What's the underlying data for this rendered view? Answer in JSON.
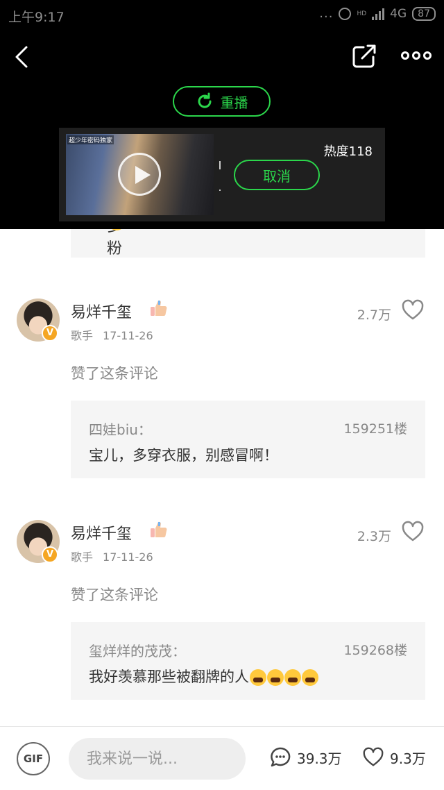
{
  "status_bar": {
    "time": "上午9:17",
    "dots": "...",
    "network": "4G",
    "network_small": "HD",
    "battery": "87"
  },
  "toolbar": {
    "back_icon": "chevron-left-icon",
    "share_icon": "share-icon",
    "more_icon": "more-dots-icon",
    "replay_label": "重播"
  },
  "ad": {
    "heat": "热度118",
    "cancel_label": "取消",
    "watermark": "超少年密码独家"
  },
  "partial": {
    "text": "多粉丝呢"
  },
  "comments": [
    {
      "name": "易烊千玺",
      "role": "歌手",
      "date": "17-11-26",
      "likes": "2.7万",
      "action": "赞了这条评论",
      "quote_user": "四娃biu：",
      "quote_floor": "159251楼",
      "quote_text": "宝儿，多穿衣服，别感冒啊！"
    },
    {
      "name": "易烊千玺",
      "role": "歌手",
      "date": "17-11-26",
      "likes": "2.3万",
      "action": "赞了这条评论",
      "quote_user": "玺烊烊的茂茂：",
      "quote_floor": "159268楼",
      "quote_text": "我好羡慕那些被翻牌的人"
    }
  ],
  "bottom_bar": {
    "gif_label": "GIF",
    "input_placeholder": "我来说一说...",
    "comment_count": "39.3万",
    "like_count": "9.3万"
  },
  "colors": {
    "accent_green": "#2bd64b",
    "badge_orange": "#f5a623"
  }
}
